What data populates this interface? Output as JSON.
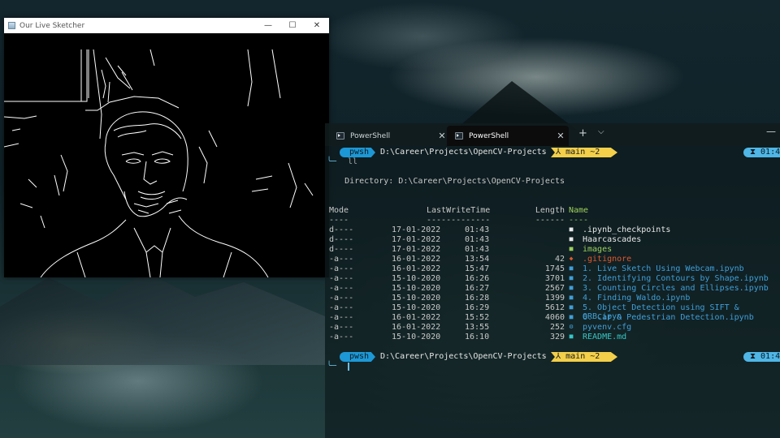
{
  "sketcher": {
    "title": "Our Live Sketcher",
    "controls": {
      "minimize": "—",
      "maximize": "☐",
      "close": "✕"
    }
  },
  "terminal": {
    "tabs": [
      {
        "label": "PowerShell",
        "close": "✕",
        "icon": "powershell-icon"
      },
      {
        "label": "PowerShell",
        "close": "✕",
        "icon": "powershell-icon"
      }
    ],
    "new_tab": "+",
    "dropdown": "⌵",
    "minimize": "—",
    "prompts": [
      {
        "shell": "pwsh",
        "path": "D:\\Career\\Projects\\OpenCV-Projects",
        "branch": "⅄ main ~2",
        "time": "⧗ 01:4",
        "arrow": "╰─",
        "command": "ll"
      },
      {
        "shell": "pwsh",
        "path": "D:\\Career\\Projects\\OpenCV-Projects",
        "branch": "⅄ main ~2",
        "time": "⧗ 01:4",
        "arrow": "╰─",
        "command": ""
      }
    ],
    "directory_line": "    Directory: D:\\Career\\Projects\\OpenCV-Projects",
    "headers": {
      "mode": "Mode",
      "lastwrite": "LastWriteTime",
      "length": "Length",
      "name": "Name"
    },
    "dashes": {
      "mode": "----",
      "lastwrite": "-------------",
      "length": "------",
      "name": "----"
    },
    "files": [
      {
        "mode": "d----",
        "date": "17-01-2022",
        "time": "01:43",
        "length": "",
        "icon": "folder-icon",
        "glyph": "■",
        "name": ".ipynb_checkpoints",
        "color": "#e8e8e8"
      },
      {
        "mode": "d----",
        "date": "17-01-2022",
        "time": "01:43",
        "length": "",
        "icon": "folder-icon",
        "glyph": "■",
        "name": "Haarcascades",
        "color": "#e8e8e8"
      },
      {
        "mode": "d----",
        "date": "17-01-2022",
        "time": "01:43",
        "length": "",
        "icon": "image-folder-icon",
        "glyph": "■",
        "name": "images",
        "color": "#9ccf5c"
      },
      {
        "mode": "-a---",
        "date": "16-01-2022",
        "time": "13:54",
        "length": "42",
        "icon": "git-icon",
        "glyph": "◆",
        "name": ".gitignore",
        "color": "#e0582c"
      },
      {
        "mode": "-a---",
        "date": "16-01-2022",
        "time": "15:47",
        "length": "1745",
        "icon": "notebook-icon",
        "glyph": "■",
        "name": "1. Live Sketch Using Webcam.ipynb",
        "color": "#3f9fd8"
      },
      {
        "mode": "-a---",
        "date": "15-10-2020",
        "time": "16:26",
        "length": "3701",
        "icon": "notebook-icon",
        "glyph": "■",
        "name": "2. Identifying Contours by Shape.ipynb",
        "color": "#3f9fd8"
      },
      {
        "mode": "-a---",
        "date": "15-10-2020",
        "time": "16:27",
        "length": "2567",
        "icon": "notebook-icon",
        "glyph": "■",
        "name": "3. Counting Circles and Ellipses.ipynb",
        "color": "#3f9fd8"
      },
      {
        "mode": "-a---",
        "date": "15-10-2020",
        "time": "16:28",
        "length": "1399",
        "icon": "notebook-icon",
        "glyph": "■",
        "name": "4. Finding Waldo.ipynb",
        "color": "#3f9fd8"
      },
      {
        "mode": "-a---",
        "date": "15-10-2020",
        "time": "16:29",
        "length": "5612",
        "icon": "notebook-icon",
        "glyph": "■",
        "name": "5. Object Detection using SIFT & ORB.ipyn",
        "color": "#3f9fd8"
      },
      {
        "mode": "-a---",
        "date": "16-01-2022",
        "time": "15:52",
        "length": "4060",
        "icon": "notebook-icon",
        "glyph": "■",
        "name": "6. Car & Pedestrian Detection.ipynb",
        "color": "#3f9fd8"
      },
      {
        "mode": "-a---",
        "date": "16-01-2022",
        "time": "13:55",
        "length": "252",
        "icon": "gear-icon",
        "glyph": "⚙",
        "name": "pyvenv.cfg",
        "color": "#3f9fd8"
      },
      {
        "mode": "-a---",
        "date": "15-10-2020",
        "time": "16:10",
        "length": "329",
        "icon": "markdown-icon",
        "glyph": "■",
        "name": "README.md",
        "color": "#36c6c6"
      }
    ]
  }
}
